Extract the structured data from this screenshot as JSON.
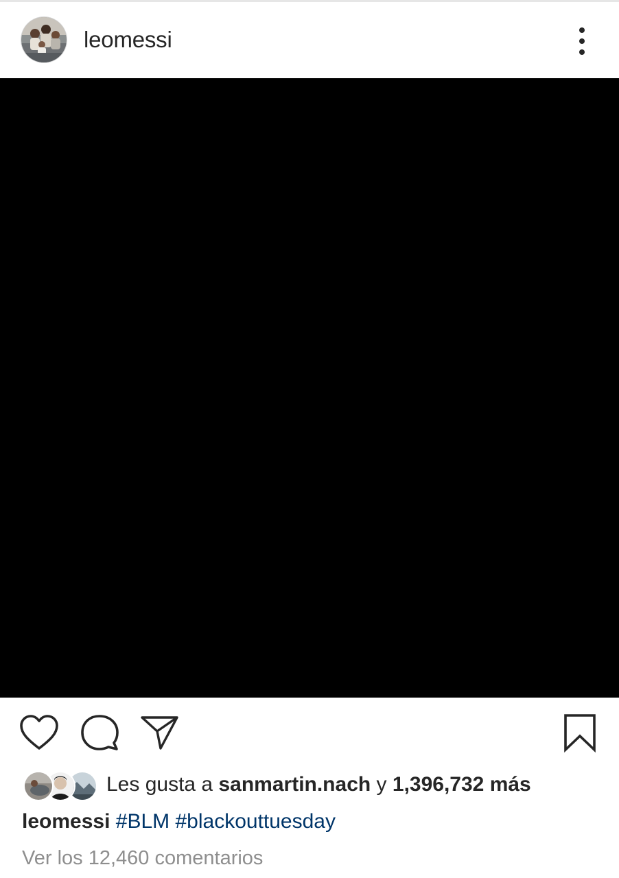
{
  "post": {
    "username": "leomessi",
    "avatar_icon": "profile-photo",
    "menu_icon": "more-vertical-icon"
  },
  "actions": {
    "icons": [
      "heart-icon",
      "comment-icon",
      "share-icon",
      "bookmark-icon"
    ]
  },
  "likes": {
    "prefix": "Les gusta a",
    "liked_by": "sanmartin.nach",
    "connector": "y",
    "others_count": "1,396,732 más"
  },
  "caption": {
    "username": "leomessi",
    "hashtags": [
      "#BLM",
      "#blackouttuesday"
    ]
  },
  "comments": {
    "view_all": "Ver los 12,460 comentarios"
  },
  "colors": {
    "text": "#262626",
    "hashtag": "#003569",
    "muted": "#8e8e8e",
    "media": "#000000"
  }
}
